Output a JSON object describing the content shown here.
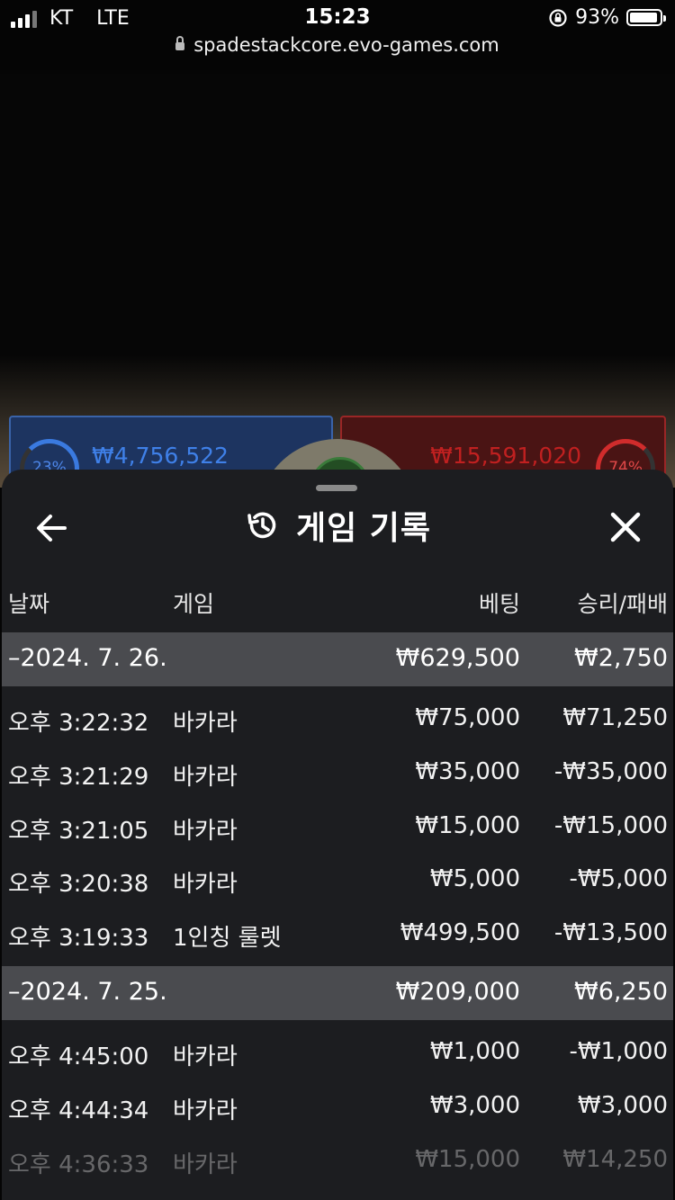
{
  "status_bar": {
    "carrier": "KT",
    "network": "LTE",
    "time": "15:23",
    "battery": "93%",
    "battery_level": 0.93
  },
  "browser": {
    "url": "spadestackcore.evo-games.com"
  },
  "game": {
    "player_percent": "23%",
    "player_amount": "₩4,756,522",
    "banker_percent": "74%",
    "banker_amount": "₩15,591,020"
  },
  "sheet": {
    "title": "게임 기록",
    "columns": {
      "date": "날짜",
      "game": "게임",
      "bet": "베팅",
      "win_loss": "승리/패배"
    },
    "groups": [
      {
        "date": "–2024. 7. 26.",
        "bet": "₩629,500",
        "win_loss": "₩2,750",
        "rows": [
          {
            "time": "오후 3:22:32",
            "game": "바카라",
            "bet": "₩75,000",
            "win_loss": "₩71,250"
          },
          {
            "time": "오후 3:21:29",
            "game": "바카라",
            "bet": "₩35,000",
            "win_loss": "-₩35,000"
          },
          {
            "time": "오후 3:21:05",
            "game": "바카라",
            "bet": "₩15,000",
            "win_loss": "-₩15,000"
          },
          {
            "time": "오후 3:20:38",
            "game": "바카라",
            "bet": "₩5,000",
            "win_loss": "-₩5,000"
          },
          {
            "time": "오후 3:19:33",
            "game": "1인칭 룰렛",
            "bet": "₩499,500",
            "win_loss": "-₩13,500"
          }
        ]
      },
      {
        "date": "–2024. 7. 25.",
        "bet": "₩209,000",
        "win_loss": "₩6,250",
        "rows": [
          {
            "time": "오후 4:45:00",
            "game": "바카라",
            "bet": "₩1,000",
            "win_loss": "-₩1,000"
          },
          {
            "time": "오후 4:44:34",
            "game": "바카라",
            "bet": "₩3,000",
            "win_loss": "₩3,000"
          },
          {
            "time": "오후 4:36:33",
            "game": "바카라",
            "bet": "₩15,000",
            "win_loss": "₩14,250"
          }
        ]
      }
    ]
  }
}
